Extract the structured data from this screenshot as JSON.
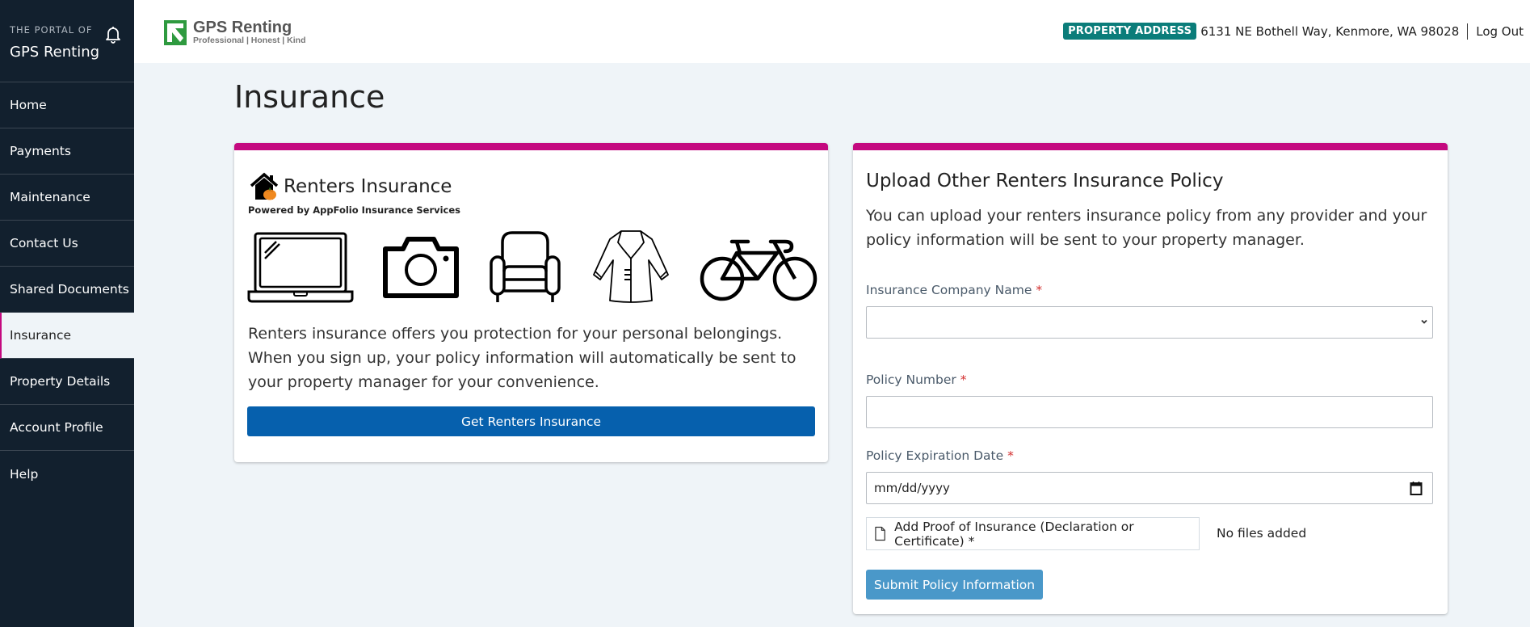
{
  "sidebar": {
    "portal_of": "THE PORTAL OF",
    "title": "GPS Renting",
    "items": [
      {
        "label": "Home",
        "active": false
      },
      {
        "label": "Payments",
        "active": false
      },
      {
        "label": "Maintenance",
        "active": false
      },
      {
        "label": "Contact Us",
        "active": false
      },
      {
        "label": "Shared Documents",
        "active": false
      },
      {
        "label": "Insurance",
        "active": true
      },
      {
        "label": "Property Details",
        "active": false
      },
      {
        "label": "Account Profile",
        "active": false
      },
      {
        "label": "Help",
        "active": false
      }
    ]
  },
  "header": {
    "logo_name": "GPS Renting",
    "logo_tagline": "Professional | Honest | Kind",
    "property_badge": "PROPERTY ADDRESS",
    "property_address": "6131 NE Bothell Way, Kenmore, WA 98028",
    "logout": "Log Out"
  },
  "page": {
    "title": "Insurance"
  },
  "renters_card": {
    "title": "Renters Insurance",
    "powered_by": "Powered by AppFolio Insurance Services",
    "icons": [
      "laptop-icon",
      "camera-icon",
      "armchair-icon",
      "coat-icon",
      "bicycle-icon"
    ],
    "description": "Renters insurance offers you protection for your personal belongings. When you sign up, your policy information will automatically be sent to your property manager for your convenience.",
    "button": "Get Renters Insurance"
  },
  "upload_card": {
    "title": "Upload Other Renters Insurance Policy",
    "description": "You can upload your renters insurance policy from any provider and your policy information will be sent to your property manager.",
    "company_label": "Insurance Company Name",
    "company_value": "",
    "policy_number_label": "Policy Number",
    "policy_number_value": "",
    "expiration_label": "Policy Expiration Date",
    "expiration_placeholder": "mm/dd/yyyy",
    "required_mark": "*",
    "file_button": "Add Proof of Insurance (Declaration or Certificate) *",
    "file_status": "No files added",
    "submit": "Submit Policy Information"
  },
  "colors": {
    "sidebar_bg": "#12202e",
    "accent_magenta": "#c4097f",
    "badge_teal": "#0b7d7a",
    "primary_blue": "#0660ad",
    "submit_blue": "#4a98c9",
    "page_bg": "#eff4f8"
  }
}
